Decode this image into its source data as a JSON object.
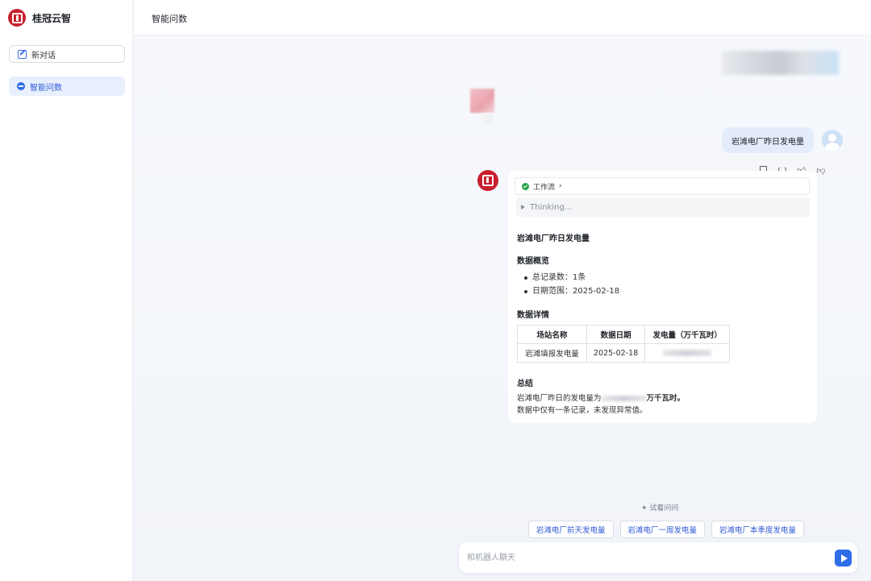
{
  "app": {
    "brand_name": "桂冠云智"
  },
  "sidebar": {
    "new_chat_label": "新对话",
    "items": [
      {
        "label": "智能问数"
      }
    ]
  },
  "header": {
    "title": "智能问数"
  },
  "conversation": {
    "user_message": "岩滩电厂昨日发电量",
    "answer": {
      "workflow_label": "工作流",
      "thinking_label": "Thinking...",
      "title": "岩滩电厂昨日发电量",
      "overview_heading": "数据概览",
      "overview_items": [
        "总记录数：1条",
        "日期范围：2025-02-18"
      ],
      "detail_heading": "数据详情",
      "table": {
        "headers": [
          "场站名称",
          "数据日期",
          "发电量（万千瓦时）"
        ],
        "rows": [
          {
            "station": "岩滩填报发电量",
            "date": "2025-02-18"
          }
        ]
      },
      "summary_heading": "总结",
      "summary_line1_prefix": "岩滩电厂昨日的发电量为",
      "summary_line1_suffix": "万千瓦时。",
      "summary_line2": "数据中仅有一条记录，未发现异常值。"
    }
  },
  "suggestions": {
    "label": "✦ 试着问问",
    "items": [
      "岩滩电厂前天发电量",
      "岩滩电厂一周发电量",
      "岩滩电厂本季度发电量"
    ]
  },
  "input": {
    "placeholder": "和机器人聊天"
  },
  "colors": {
    "accent": "#2f6ce8",
    "brand_red": "#c81f2d",
    "success": "#22a447"
  }
}
